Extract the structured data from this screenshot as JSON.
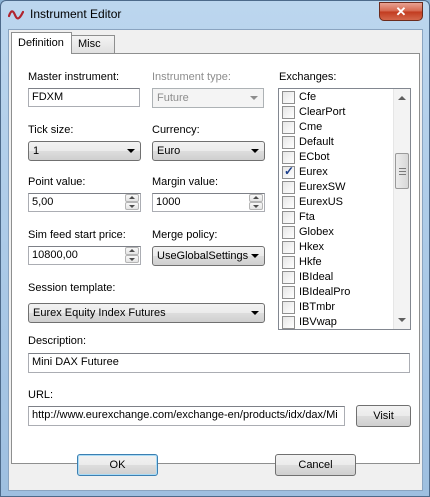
{
  "window": {
    "title": "Instrument Editor",
    "close_glyph": "✕"
  },
  "tabs": [
    {
      "label": "Definition",
      "active": true
    },
    {
      "label": "Misc",
      "active": false
    }
  ],
  "form": {
    "master_instrument": {
      "label": "Master instrument:",
      "value": "FDXM"
    },
    "instrument_type": {
      "label": "Instrument type:",
      "value": "Future",
      "disabled": true
    },
    "tick_size": {
      "label": "Tick size:",
      "value": "1"
    },
    "currency": {
      "label": "Currency:",
      "value": "Euro"
    },
    "point_value": {
      "label": "Point value:",
      "value": "5,00"
    },
    "margin_value": {
      "label": "Margin value:",
      "value": "1000"
    },
    "sim_feed_start_price": {
      "label": "Sim feed start price:",
      "value": "10800,00"
    },
    "merge_policy": {
      "label": "Merge policy:",
      "value": "UseGlobalSettings"
    },
    "session_template": {
      "label": "Session template:",
      "value": "Eurex Equity Index Futures"
    },
    "description": {
      "label": "Description:",
      "value": "Mini DAX Futuree"
    },
    "url": {
      "label": "URL:",
      "value": "http://www.eurexchange.com/exchange-en/products/idx/dax/Mi"
    }
  },
  "exchanges": {
    "label": "Exchanges:",
    "items": [
      {
        "name": "Cfe",
        "checked": false
      },
      {
        "name": "ClearPort",
        "checked": false
      },
      {
        "name": "Cme",
        "checked": false
      },
      {
        "name": "Default",
        "checked": false
      },
      {
        "name": "ECbot",
        "checked": false
      },
      {
        "name": "Eurex",
        "checked": true
      },
      {
        "name": "EurexSW",
        "checked": false
      },
      {
        "name": "EurexUS",
        "checked": false
      },
      {
        "name": "Fta",
        "checked": false
      },
      {
        "name": "Globex",
        "checked": false
      },
      {
        "name": "Hkex",
        "checked": false
      },
      {
        "name": "Hkfe",
        "checked": false
      },
      {
        "name": "IBIdeal",
        "checked": false
      },
      {
        "name": "IBIdealPro",
        "checked": false
      },
      {
        "name": "IBTmbr",
        "checked": false
      },
      {
        "name": "IBVwap",
        "checked": false
      }
    ]
  },
  "buttons": {
    "visit": "Visit",
    "ok": "OK",
    "cancel": "Cancel"
  },
  "icons": {
    "app": "instrument-editor-icon",
    "close": "close-icon",
    "check": "checkmark-icon"
  },
  "colors": {
    "title_gradient_top": "#bcd6ee",
    "close_button": "#c13a1e",
    "check_mark": "#1c3f8c"
  }
}
